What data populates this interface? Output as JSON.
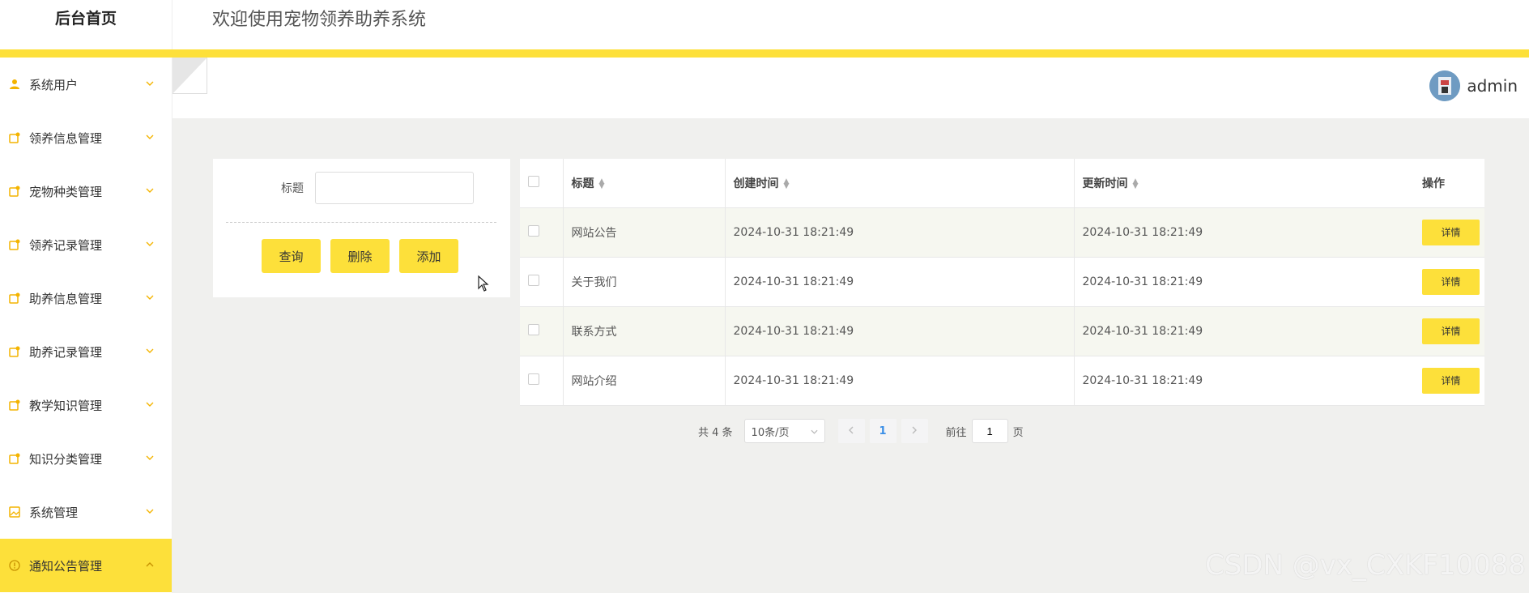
{
  "header": {
    "brand": "后台首页",
    "welcome": "欢迎使用宠物领养助养系统"
  },
  "sidebar": {
    "items": [
      {
        "label": "系统用户",
        "icon": "user-icon"
      },
      {
        "label": "领养信息管理",
        "icon": "document-icon"
      },
      {
        "label": "宠物种类管理",
        "icon": "document-icon"
      },
      {
        "label": "领养记录管理",
        "icon": "document-icon"
      },
      {
        "label": "助养信息管理",
        "icon": "document-icon"
      },
      {
        "label": "助养记录管理",
        "icon": "document-icon"
      },
      {
        "label": "教学知识管理",
        "icon": "document-icon"
      },
      {
        "label": "知识分类管理",
        "icon": "document-icon"
      },
      {
        "label": "系统管理",
        "icon": "image-icon"
      },
      {
        "label": "通知公告管理",
        "icon": "info-icon"
      }
    ]
  },
  "user": {
    "name": "admin"
  },
  "search": {
    "label": "标题",
    "value": "",
    "query_label": "查询",
    "delete_label": "删除",
    "add_label": "添加"
  },
  "table": {
    "columns": [
      "标题",
      "创建时间",
      "更新时间",
      "操作"
    ],
    "rows": [
      {
        "title": "网站公告",
        "created": "2024-10-31 18:21:49",
        "updated": "2024-10-31 18:21:49",
        "action": "详情"
      },
      {
        "title": "关于我们",
        "created": "2024-10-31 18:21:49",
        "updated": "2024-10-31 18:21:49",
        "action": "详情"
      },
      {
        "title": "联系方式",
        "created": "2024-10-31 18:21:49",
        "updated": "2024-10-31 18:21:49",
        "action": "详情"
      },
      {
        "title": "网站介绍",
        "created": "2024-10-31 18:21:49",
        "updated": "2024-10-31 18:21:49",
        "action": "详情"
      }
    ]
  },
  "pagination": {
    "total": "共 4 条",
    "page_size": "10条/页",
    "current_page": "1",
    "goto_label": "前往",
    "goto_value": "1",
    "page_suffix": "页"
  },
  "watermark": "CSDN @vx_CXKF10088",
  "colors": {
    "accent": "#fde03a",
    "icon": "#f4b400",
    "page_link": "#3a8ee6"
  }
}
